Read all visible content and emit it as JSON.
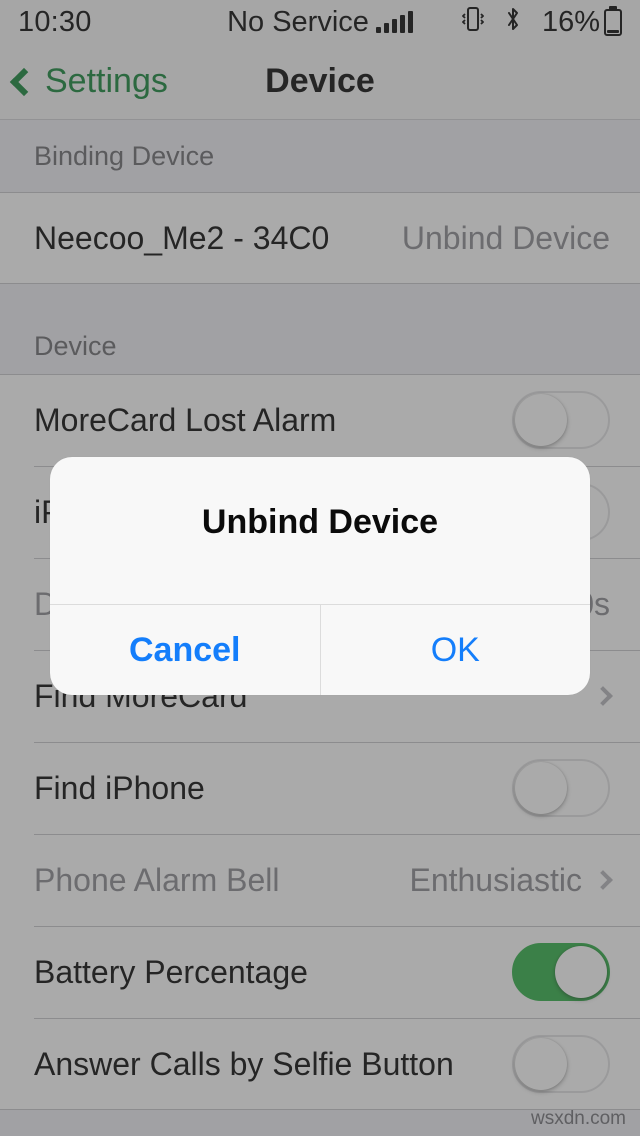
{
  "status_bar": {
    "time": "10:30",
    "carrier": "No Service",
    "signal_bars": 5,
    "signal_icon": "cellular-signal-icon",
    "vibrate_icon": "vibrate-icon",
    "bluetooth_icon": "bluetooth-icon",
    "battery_percent": "16%",
    "battery_level": 16,
    "battery_icon": "battery-icon"
  },
  "nav": {
    "back_label": "Settings",
    "back_icon": "chevron-left-icon",
    "title": "Device"
  },
  "sections": [
    {
      "header": "Binding Device",
      "rows": [
        {
          "title": "Neecoo_Me2 - 34C0",
          "action": "Unbind Device",
          "type": "action"
        }
      ]
    },
    {
      "header": "Device",
      "rows": [
        {
          "title": "MoreCard Lost Alarm",
          "type": "switch",
          "on": false
        },
        {
          "title": "iPhone Lost Alarm",
          "type": "switch",
          "on": false
        },
        {
          "title": "Delay Alarm",
          "type": "stepper",
          "value": "60s",
          "muted": true
        },
        {
          "title": "Find MoreCard",
          "type": "disclosure"
        },
        {
          "title": "Find iPhone",
          "type": "switch",
          "on": false
        },
        {
          "title": "Phone Alarm Bell",
          "type": "disclosure",
          "value": "Enthusiastic",
          "muted": true
        },
        {
          "title": "Battery Percentage",
          "type": "switch",
          "on": true
        },
        {
          "title": "Answer Calls by Selfie Button",
          "type": "switch",
          "on": false
        }
      ]
    }
  ],
  "alert": {
    "title": "Unbind Device",
    "message": "",
    "cancel_label": "Cancel",
    "ok_label": "OK"
  },
  "watermark": "wsxdn.com",
  "colors": {
    "accent_green": "#17883c",
    "switch_on": "#33b24a",
    "alert_blue": "#147efb",
    "muted_text": "#8c8c92"
  }
}
